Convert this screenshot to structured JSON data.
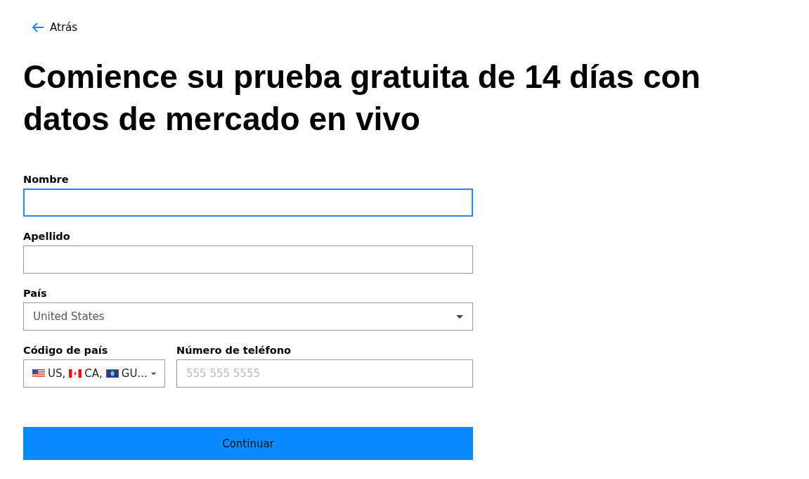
{
  "back_link": {
    "label": "Atrás"
  },
  "heading": "Comience su prueba gratuita de 14 días con datos de mercado en vivo",
  "fields": [
    {
      "label": "Nombre",
      "kind": "text",
      "focused": true
    },
    {
      "label": "Apellido",
      "kind": "text",
      "focused": false
    },
    {
      "label": "País",
      "kind": "select",
      "value": "United States",
      "focused": false
    }
  ],
  "country_code": {
    "label": "Código de país",
    "options": [
      {
        "code": "US,"
      },
      {
        "code": "CA,"
      },
      {
        "code": "GU..."
      }
    ]
  },
  "phone": {
    "label": "Número de teléfono",
    "placeholder": "555 555 5555"
  },
  "submit": {
    "label": "Continuar"
  }
}
